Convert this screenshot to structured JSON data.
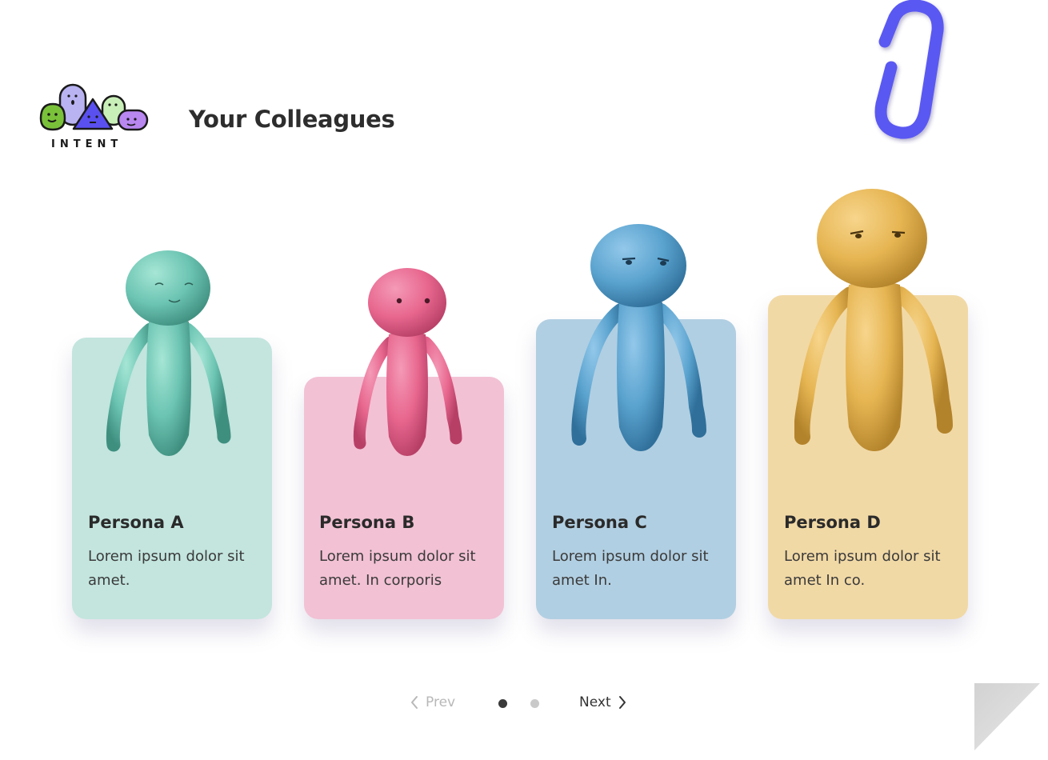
{
  "brand": {
    "logo_text": "INTENT"
  },
  "header": {
    "title": "Your Colleagues"
  },
  "personas": [
    {
      "name": "Persona A",
      "description": "Lorem ipsum dolor sit amet.",
      "color": "#6cc4b2",
      "card_color": "#c3e5de"
    },
    {
      "name": "Persona B",
      "description": "Lorem ipsum dolor sit amet. In corporis",
      "color": "#e8678f",
      "card_color": "#f2c1d4"
    },
    {
      "name": "Persona C",
      "description": "Lorem ipsum dolor sit amet In.",
      "color": "#5aa3cf",
      "card_color": "#b1cfe2"
    },
    {
      "name": "Persona D",
      "description": "Lorem ipsum dolor sit amet In co.",
      "color": "#e6b552",
      "card_color": "#f1d9a6"
    }
  ],
  "pagination": {
    "prev_label": "Prev",
    "next_label": "Next",
    "current_page": 1,
    "total_pages": 2
  },
  "icons": {
    "clip": "paperclip-icon",
    "prev": "chevron-left-icon",
    "next": "chevron-right-icon",
    "corner": "page-curl-icon"
  }
}
